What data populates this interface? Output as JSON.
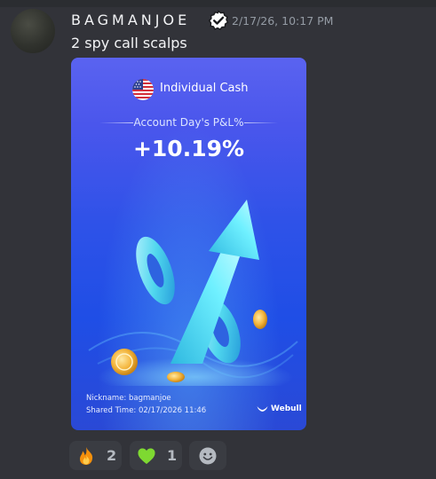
{
  "message": {
    "username": "BAGMANJOE",
    "timestamp": "2/17/26, 10:17 PM",
    "content": "2 spy call scalps"
  },
  "card": {
    "account_type": "Individual Cash",
    "pl_label": "Account Day's P&L%",
    "pl_value": "+10.19%",
    "nickname": "Nickname: bagmanjoe",
    "shared_time": "Shared Time: 02/17/2026 11:46",
    "brand": "Webull",
    "flag_icon": "us-flag-icon",
    "illustration_icon": "percent-arrow-coins-illustration"
  },
  "reactions": [
    {
      "icon": "fire-emoji",
      "count": "2"
    },
    {
      "icon": "green-heart-emoji",
      "count": "1"
    },
    {
      "icon": "add-reaction-icon",
      "count": ""
    }
  ]
}
